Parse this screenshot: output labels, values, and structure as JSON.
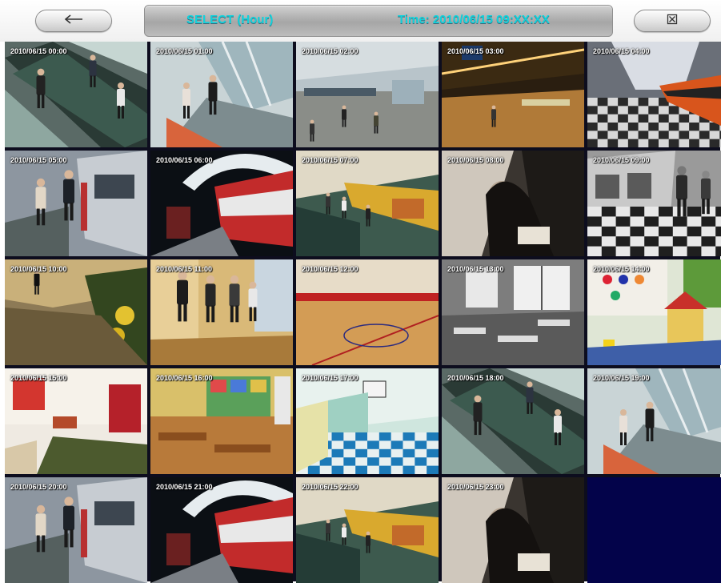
{
  "header": {
    "title": "SELECT (Hour)",
    "time": "Time: 2010/06/15 09:XX:XX",
    "back_icon": "arrow-left-icon",
    "close_icon": "close-box-icon"
  },
  "colors": {
    "title_text": "#11d2dc",
    "selected_border": "#dd1111",
    "empty_cell": "#03034a"
  },
  "cells": [
    {
      "label": "2010/06/15 00:00",
      "scene": "escalator",
      "selected": false
    },
    {
      "label": "2010/06/15 01:00",
      "scene": "mall",
      "selected": false
    },
    {
      "label": "2010/06/15 02:00",
      "scene": "airport-hall",
      "selected": false
    },
    {
      "label": "2010/06/15 03:00",
      "scene": "terminal-night",
      "selected": false
    },
    {
      "label": "2010/06/15 04:00",
      "scene": "train-platform",
      "selected": false
    },
    {
      "label": "2010/06/15 05:00",
      "scene": "train-door",
      "selected": false
    },
    {
      "label": "2010/06/15 06:00",
      "scene": "station-red",
      "selected": false
    },
    {
      "label": "2010/06/15 07:00",
      "scene": "station-stairs",
      "selected": false
    },
    {
      "label": "2010/06/15 08:00",
      "scene": "sepia-woman",
      "selected": false
    },
    {
      "label": "2010/06/15 09:00",
      "scene": "bw-train",
      "selected": true
    },
    {
      "label": "2010/06/15 10:00",
      "scene": "garden-walk",
      "selected": false
    },
    {
      "label": "2010/06/15 11:00",
      "scene": "office-people",
      "selected": false
    },
    {
      "label": "2010/06/15 12:00",
      "scene": "gym",
      "selected": false
    },
    {
      "label": "2010/06/15 13:00",
      "scene": "classroom-bw",
      "selected": false
    },
    {
      "label": "2010/06/15 14:00",
      "scene": "kids-room",
      "selected": false
    },
    {
      "label": "2010/06/15 15:00",
      "scene": "living-room",
      "selected": false
    },
    {
      "label": "2010/06/15 16:00",
      "scene": "school-class",
      "selected": false
    },
    {
      "label": "2010/06/15 17:00",
      "scene": "checker-hall",
      "selected": false
    },
    {
      "label": "2010/06/15 18:00",
      "scene": "escalator",
      "selected": false
    },
    {
      "label": "2010/06/15 19:00",
      "scene": "mall",
      "selected": false
    },
    {
      "label": "2010/06/15 20:00",
      "scene": "train-door",
      "selected": false
    },
    {
      "label": "2010/06/15 21:00",
      "scene": "station-red",
      "selected": false
    },
    {
      "label": "2010/06/15 22:00",
      "scene": "station-stairs",
      "selected": false
    },
    {
      "label": "2010/06/15 23:00",
      "scene": "sepia-woman",
      "selected": false
    },
    {
      "label": "",
      "scene": "empty",
      "selected": false
    }
  ]
}
